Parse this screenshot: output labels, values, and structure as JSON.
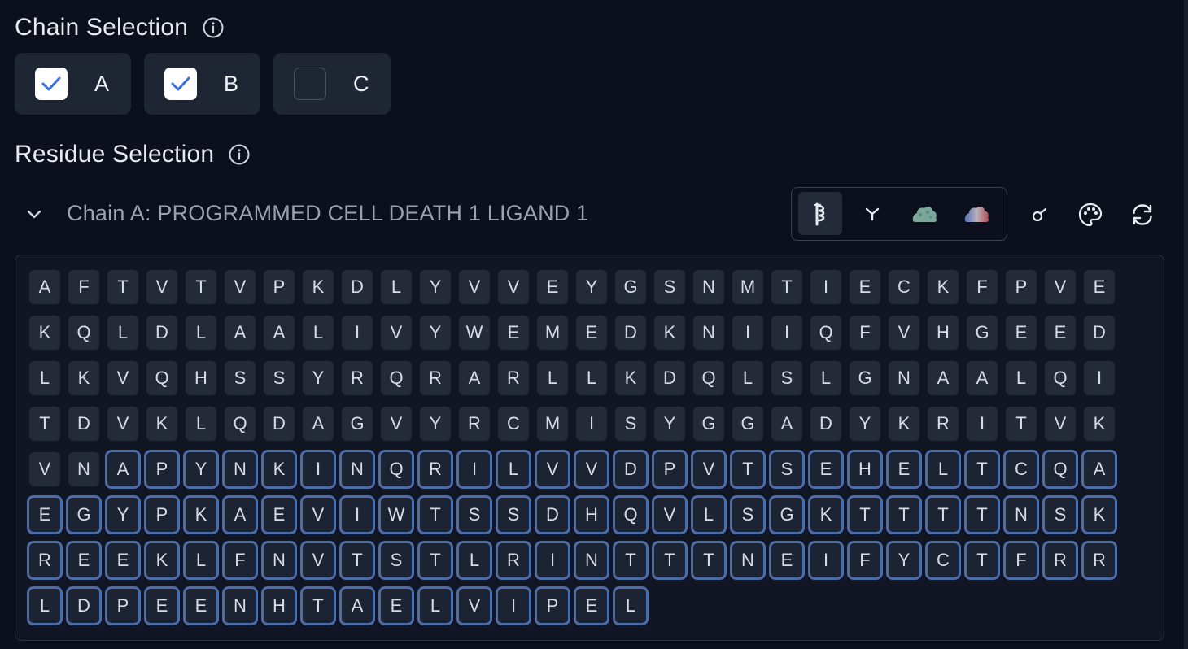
{
  "chain_selection": {
    "title": "Chain Selection",
    "chains": [
      {
        "label": "A",
        "checked": true
      },
      {
        "label": "B",
        "checked": true
      },
      {
        "label": "C",
        "checked": false
      }
    ]
  },
  "residue_selection": {
    "title": "Residue Selection",
    "chain_header": "Chain A: PROGRAMMED CELL DEATH 1 LIGAND 1",
    "view_modes": [
      "cartoon-icon",
      "stick-icon",
      "surface-icon",
      "electrostatic-surface-icon"
    ],
    "active_view_mode": "cartoon-icon",
    "tools": [
      "selection-tool-icon",
      "palette-icon",
      "refresh-icon"
    ],
    "rows": [
      "AFTVTVPKDLYVVEYGSNMTIECKFPVE",
      "KQLDLAALIVYWEMEDKNIIQFVHGEED",
      "LKVQHSSYRQRARLLKDQLSLGNAALQI",
      "TDVKLQDAGVYRCMISYGGADYKRITVK",
      "VNAPYNKINQRILVVDPVTSEHELTCQA",
      "EGYPKAEVIWTSSDHQVLSGKTTTTNSK",
      "REEKLFNVTSTLRINTTTNEIFYCTFRR",
      "LDPEENHTAELVIPEL"
    ],
    "selection_start": {
      "row": 4,
      "col": 2
    },
    "accent_color": "#4b6ea9"
  }
}
